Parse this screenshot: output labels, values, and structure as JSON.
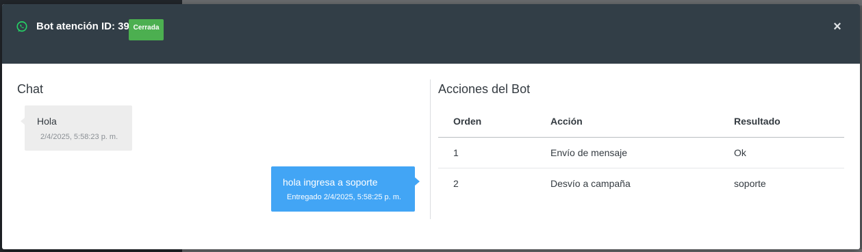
{
  "modal": {
    "title": "Bot atención ID: 39",
    "status_badge": "Cerrada",
    "close_label": "×",
    "colors": {
      "header_bg": "#323e47",
      "badge": "#4caf50",
      "outgoing_bubble": "#42a5f5",
      "incoming_bubble": "#ededed",
      "whatsapp_icon": "#25d366"
    }
  },
  "chat": {
    "title": "Chat",
    "messages": [
      {
        "direction": "incoming",
        "text": "Hola",
        "time": "2/4/2025, 5:58:23 p. m."
      },
      {
        "direction": "outgoing",
        "text": "hola ingresa a soporte",
        "time": "Entregado 2/4/2025, 5:58:25 p. m."
      }
    ]
  },
  "bot_actions": {
    "title": "Acciones del Bot",
    "columns": [
      "Orden",
      "Acción",
      "Resultado"
    ],
    "rows": [
      [
        "1",
        "Envío de mensaje",
        "Ok"
      ],
      [
        "2",
        "Desvío a campaña",
        "soporte"
      ]
    ]
  },
  "icons": {
    "header_icon": "whatsapp-icon",
    "close": "close-icon"
  }
}
